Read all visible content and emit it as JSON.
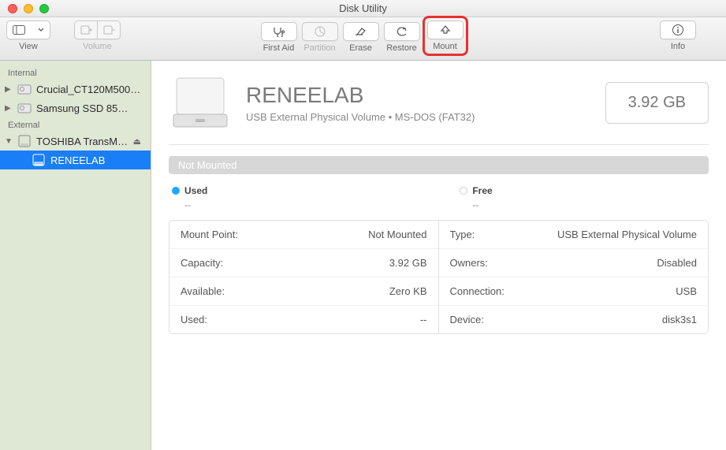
{
  "window": {
    "title": "Disk Utility"
  },
  "toolbar": {
    "view_label": "View",
    "volume_label": "Volume",
    "firstaid_label": "First Aid",
    "partition_label": "Partition",
    "erase_label": "Erase",
    "restore_label": "Restore",
    "mount_label": "Mount",
    "info_label": "Info"
  },
  "sidebar": {
    "internal_header": "Internal",
    "external_header": "External",
    "items": {
      "crucial": "Crucial_CT120M500…",
      "samsung": "Samsung SSD 85…",
      "toshiba": "TOSHIBA TransM…",
      "reneelab": "RENEELAB"
    }
  },
  "volume": {
    "name": "RENEELAB",
    "subtitle": "USB External Physical Volume • MS-DOS (FAT32)",
    "size": "3.92 GB",
    "status": "Not Mounted",
    "used_label": "Used",
    "used_value": "--",
    "free_label": "Free",
    "free_value": "--"
  },
  "details": {
    "left": [
      {
        "k": "Mount Point:",
        "v": "Not Mounted"
      },
      {
        "k": "Capacity:",
        "v": "3.92 GB"
      },
      {
        "k": "Available:",
        "v": "Zero KB"
      },
      {
        "k": "Used:",
        "v": "--"
      }
    ],
    "right": [
      {
        "k": "Type:",
        "v": "USB External Physical Volume"
      },
      {
        "k": "Owners:",
        "v": "Disabled"
      },
      {
        "k": "Connection:",
        "v": "USB"
      },
      {
        "k": "Device:",
        "v": "disk3s1"
      }
    ]
  }
}
